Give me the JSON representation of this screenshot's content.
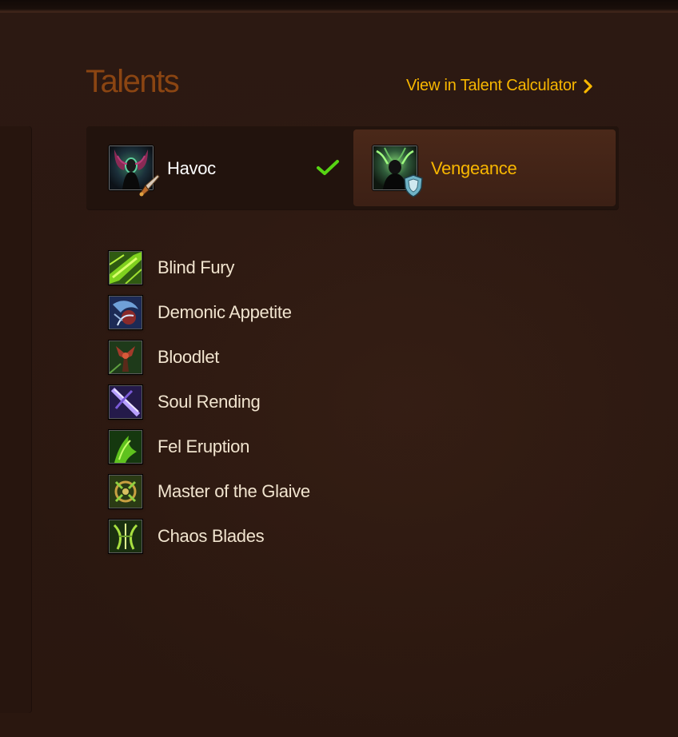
{
  "section": {
    "title": "Talents",
    "calculator_link_label": "View in Talent Calculator"
  },
  "specs": [
    {
      "name": "Havoc",
      "selected": true,
      "icon": "havoc-spec-icon",
      "badge": "dagger-damage-role-icon"
    },
    {
      "name": "Vengeance",
      "selected": false,
      "icon": "vengeance-spec-icon",
      "badge": "shield-tank-role-icon"
    }
  ],
  "talents": [
    {
      "name": "Blind Fury",
      "icon": "blind-fury-icon"
    },
    {
      "name": "Demonic Appetite",
      "icon": "demonic-appetite-icon"
    },
    {
      "name": "Bloodlet",
      "icon": "bloodlet-icon"
    },
    {
      "name": "Soul Rending",
      "icon": "soul-rending-icon"
    },
    {
      "name": "Fel Eruption",
      "icon": "fel-eruption-icon"
    },
    {
      "name": "Master of the Glaive",
      "icon": "master-of-the-glaive-icon"
    },
    {
      "name": "Chaos Blades",
      "icon": "chaos-blades-icon"
    }
  ],
  "colors": {
    "title": "#8b4512",
    "link": "#f8b700",
    "active_spec": "#ffffff",
    "inactive_spec": "#f8b700",
    "check": "#57d413",
    "talent_text": "#f1e4cf"
  }
}
